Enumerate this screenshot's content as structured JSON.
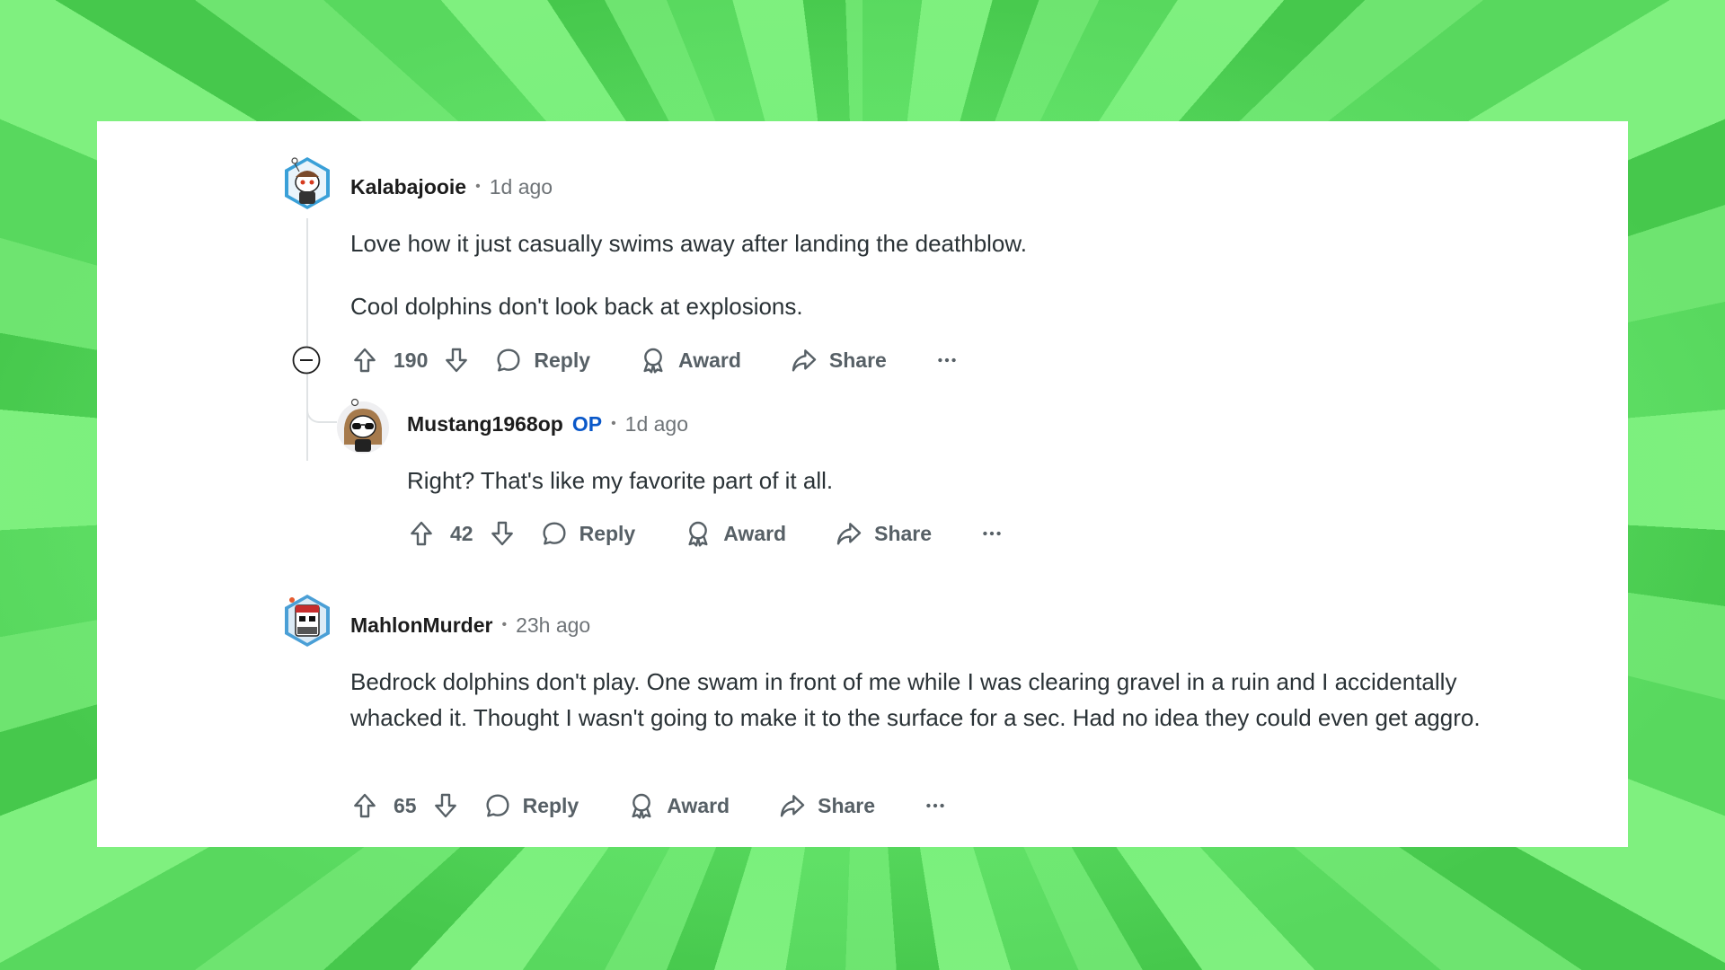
{
  "comments": [
    {
      "username": "Kalabajooie",
      "timestamp": "1d ago",
      "body": [
        "Love how it just casually swims away after landing the deathblow.",
        "Cool dolphins don't look back at explosions."
      ],
      "votes": "190",
      "actions": {
        "reply": "Reply",
        "award": "Award",
        "share": "Share",
        "more": "···"
      }
    },
    {
      "username": "Mustang1968op",
      "badge": "OP",
      "timestamp": "1d ago",
      "body": [
        "Right? That's like my favorite part of it all."
      ],
      "votes": "42",
      "actions": {
        "reply": "Reply",
        "award": "Award",
        "share": "Share",
        "more": "···"
      }
    },
    {
      "username": "MahlonMurder",
      "timestamp": "23h ago",
      "body": [
        "Bedrock dolphins don't play. One swam in front of me while I was clearing gravel in a ruin and I accidentally whacked it. Thought I wasn't going to make it to the surface for a sec. Had no idea they could even get aggro."
      ],
      "votes": "65",
      "actions": {
        "reply": "Reply",
        "award": "Award",
        "share": "Share",
        "more": "···"
      }
    }
  ],
  "colors": {
    "text": "#2a3236",
    "meta": "#6e7377",
    "op": "#0a58c9",
    "action": "#576066",
    "background": "#6ee470"
  },
  "icons": [
    "upvote-icon",
    "downvote-icon",
    "comment-bubble-icon",
    "award-ribbon-icon",
    "share-arrow-icon",
    "more-dots-icon",
    "collapse-minus-icon"
  ]
}
